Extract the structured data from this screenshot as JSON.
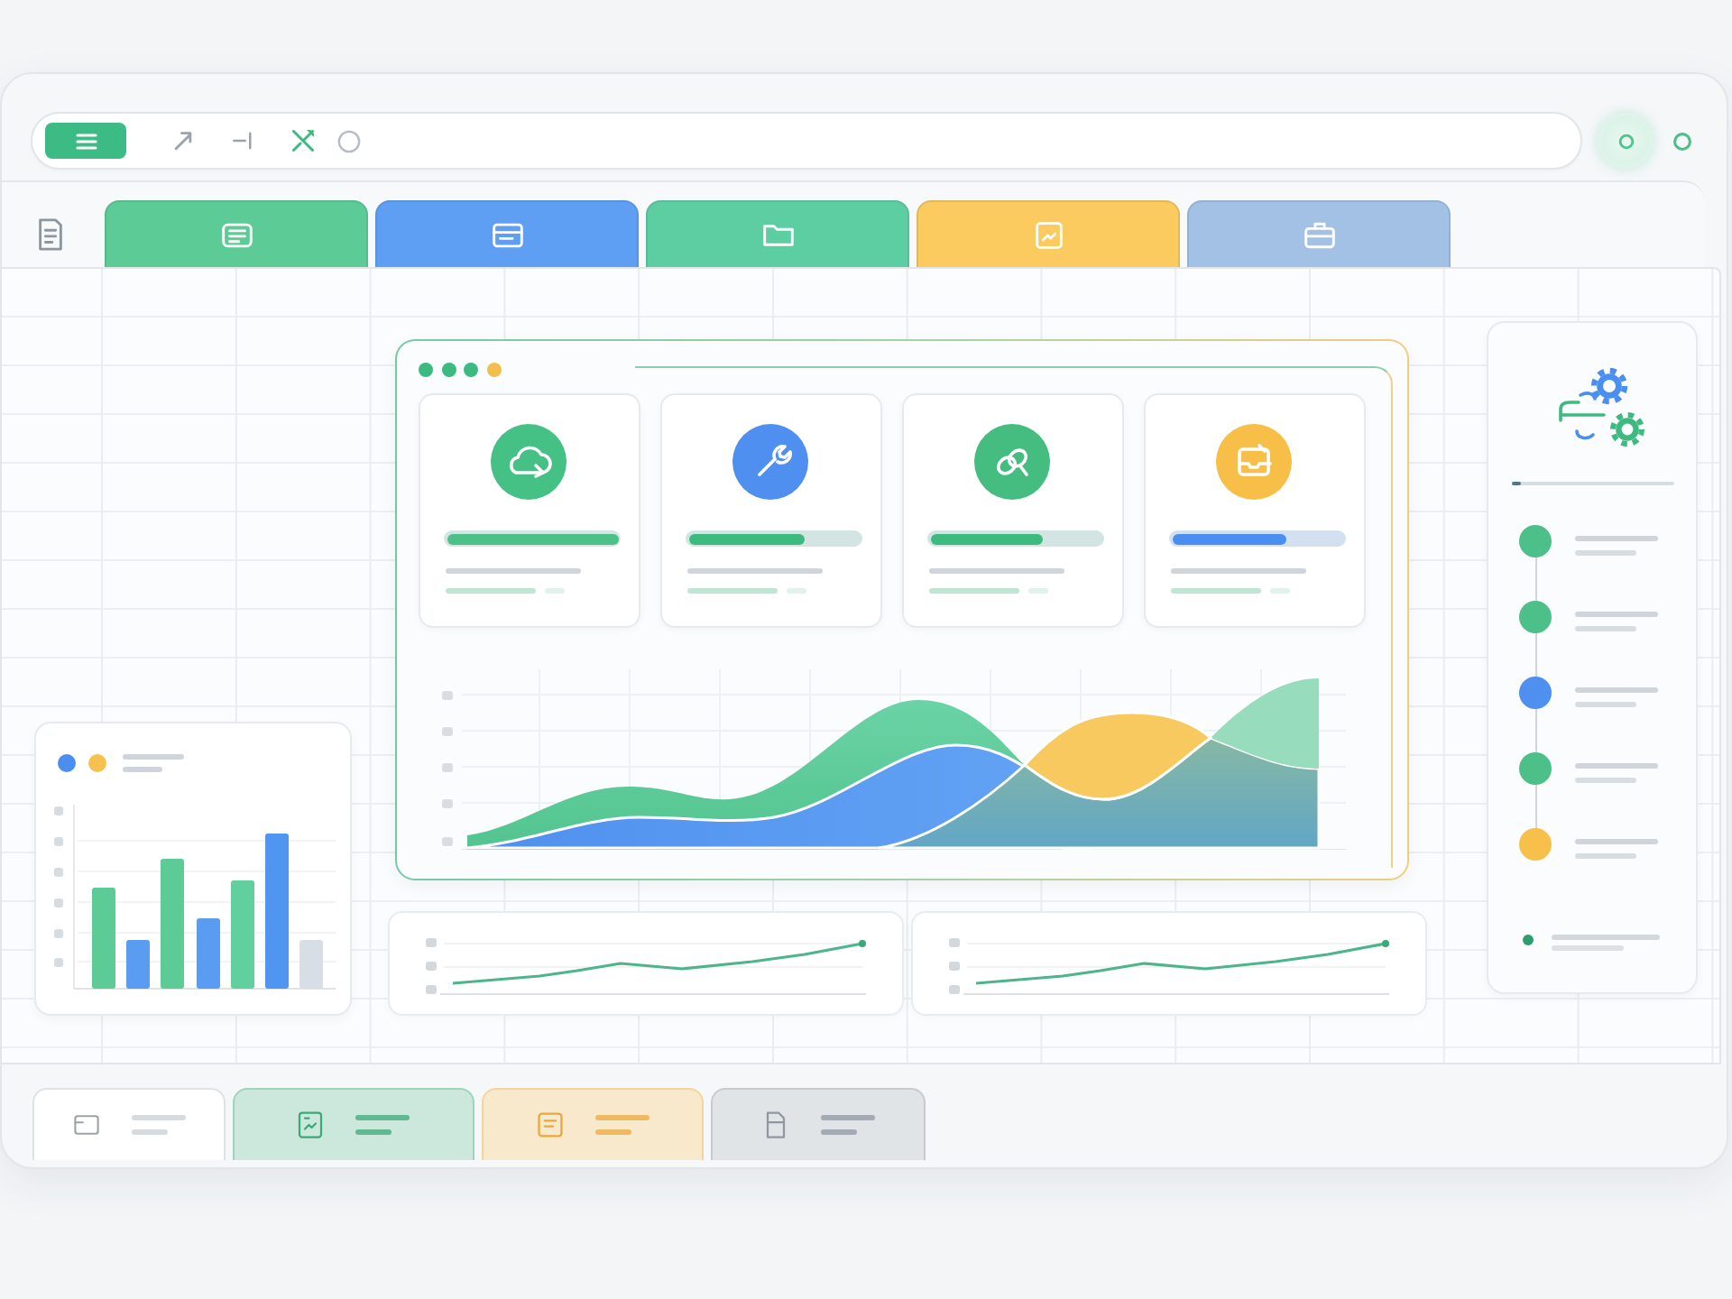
{
  "tabs": [
    {
      "kind": "list",
      "color": "#5dcb95"
    },
    {
      "kind": "window",
      "color": "#5e9ff3"
    },
    {
      "kind": "folder",
      "color": "#5dcea2"
    },
    {
      "kind": "chart",
      "color": "#fbcb5f"
    },
    {
      "kind": "briefcase",
      "color": "#a3c0e5"
    }
  ],
  "main_panel": {
    "window_dots": [
      {
        "color": "#3dba7f"
      },
      {
        "color": "#3dba7f"
      },
      {
        "color": "#3dba7f"
      },
      {
        "color": "#f2bf4f"
      }
    ],
    "cards": [
      {
        "icon": {
          "kind": "cloud",
          "color": "#45c185"
        },
        "progress": {
          "level": 1,
          "color": "#4cc088"
        }
      },
      {
        "icon": {
          "kind": "wrench",
          "color": "#4f8ff0"
        },
        "progress": {
          "level": 0.68,
          "color": "#3dba7f"
        }
      },
      {
        "icon": {
          "kind": "link",
          "color": "#45bd80"
        },
        "progress": {
          "level": 0.66,
          "color": "#3dba7f"
        }
      },
      {
        "icon": {
          "kind": "inbox",
          "color": "#f7be48"
        },
        "progress": {
          "level": 0.67,
          "color": "#4a8ff0"
        }
      }
    ]
  },
  "bar_chart": {
    "legend": [
      {
        "color": "#4a8ff0"
      },
      {
        "color": "#f6c14e"
      }
    ]
  },
  "timeline": {
    "progress": {
      "level": 0.06
    },
    "steps": [
      {
        "color": "#4cc088"
      },
      {
        "color": "#4cc088"
      },
      {
        "color": "#4f8ff0"
      },
      {
        "color": "#4cc088"
      },
      {
        "color": "#f7c04a"
      }
    ],
    "footer_dot": {
      "color": "#2e9e6c"
    }
  },
  "bottom_tabs": [
    {
      "kind": "window",
      "selected": true,
      "color": "#9aa2ab"
    },
    {
      "kind": "chart",
      "selected": false,
      "color": "#3aa877"
    },
    {
      "kind": "note",
      "selected": false,
      "color": "#e9a93a"
    },
    {
      "kind": "file",
      "selected": false,
      "color": "#8d96a1"
    }
  ]
}
